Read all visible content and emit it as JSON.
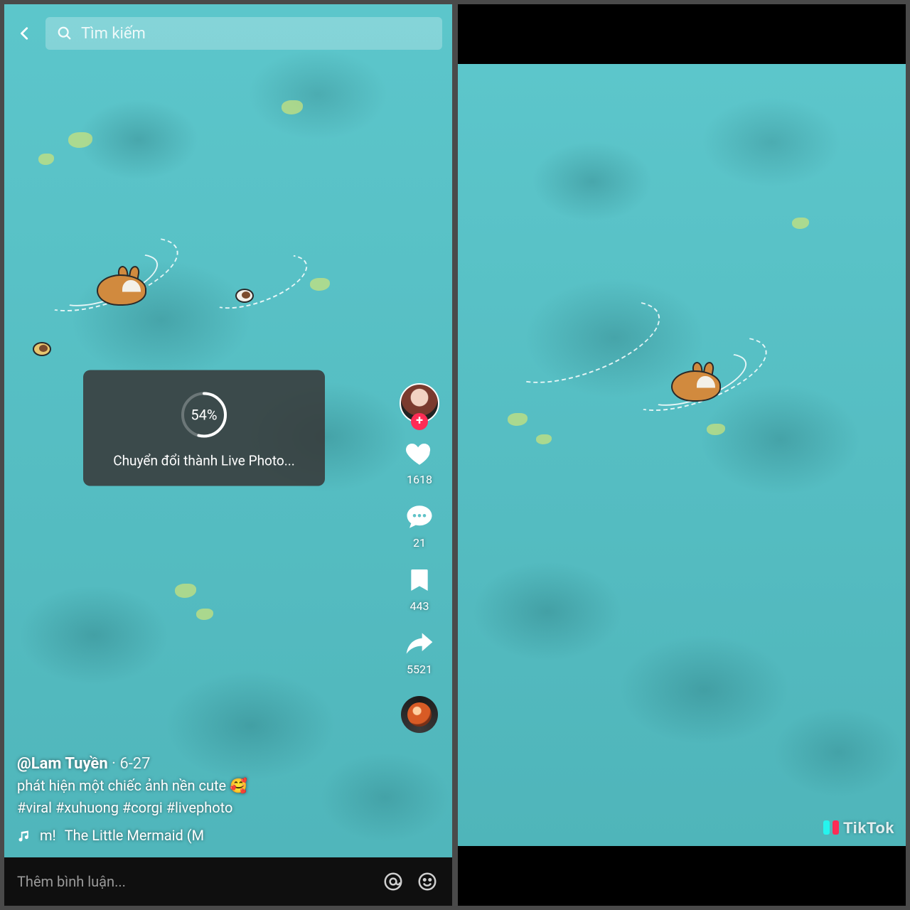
{
  "search": {
    "placeholder": "Tìm kiếm"
  },
  "toast": {
    "percent": "54%",
    "progress_value": 54,
    "label": "Chuyển đổi thành Live Photo..."
  },
  "rail": {
    "likes": "1618",
    "comments": "21",
    "saves": "443",
    "shares": "5521"
  },
  "post": {
    "username": "@Lam Tuyền",
    "date_sep": " · ",
    "date": "6-27",
    "caption": "phát hiện một chiếc ảnh nền cute 🥰",
    "hashtags": "#viral #xuhuong #corgi #livephoto",
    "music_prefix": "m!",
    "music_title": "The Little Mermaid (M"
  },
  "commentbar": {
    "placeholder": "Thêm bình luận..."
  },
  "watermark": "TikTok"
}
